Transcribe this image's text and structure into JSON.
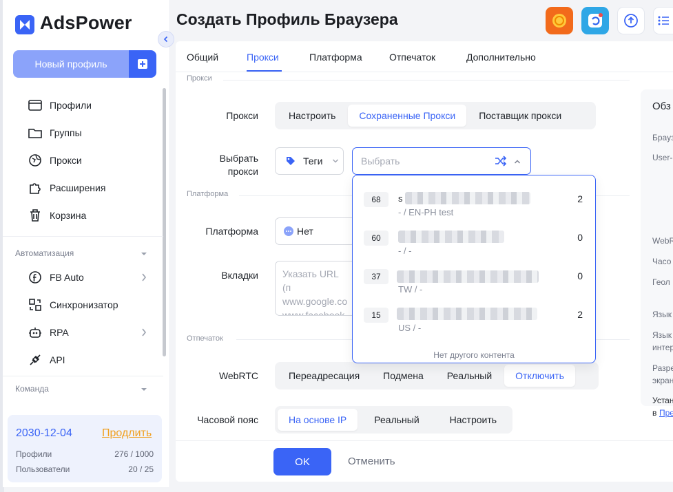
{
  "app": {
    "logo_text": "AdsPower"
  },
  "sidebar": {
    "new_profile": "Новый профиль",
    "items": [
      {
        "label": "Профили",
        "icon": "profiles-icon"
      },
      {
        "label": "Группы",
        "icon": "folder-icon"
      },
      {
        "label": "Прокси",
        "icon": "proxy-globe-icon"
      },
      {
        "label": "Расширения",
        "icon": "puzzle-icon"
      },
      {
        "label": "Корзина",
        "icon": "trash-icon"
      }
    ],
    "automation_title": "Автоматизация",
    "automation_items": [
      {
        "label": "FB Auto",
        "icon": "facebook-icon"
      },
      {
        "label": "Синхронизатор",
        "icon": "sync-icon"
      },
      {
        "label": "RPA",
        "icon": "robot-icon"
      },
      {
        "label": "API",
        "icon": "api-icon"
      }
    ],
    "team_title": "Команда",
    "subscription": {
      "date": "2030-12-04",
      "renew": "Продлить",
      "profiles_label": "Профили",
      "profiles_value": "276 / 1000",
      "users_label": "Пользователи",
      "users_value": "20 / 25"
    }
  },
  "page": {
    "title": "Создать Профиль Браузера"
  },
  "tabs": [
    "Общий",
    "Прокси",
    "Платформа",
    "Отпечаток",
    "Дополнительно"
  ],
  "proxy_section": {
    "title": "Прокси",
    "proxy_label": "Прокси",
    "proxy_options": [
      "Настроить",
      "Сохраненные Прокси",
      "Поставщик прокси"
    ],
    "select_label_1": "Выбрать",
    "select_label_2": "прокси",
    "tags_label": "Теги",
    "select_placeholder": "Выбрать"
  },
  "dropdown": {
    "items": [
      {
        "id": "68",
        "line1_prefix": "s",
        "line2": "- / EN-PH test",
        "count": "2"
      },
      {
        "id": "60",
        "line1_prefix": "",
        "line2": "- / -",
        "count": "0"
      },
      {
        "id": "37",
        "line1_prefix": "",
        "line2": "TW / -",
        "count": "0"
      },
      {
        "id": "15",
        "line1_prefix": "",
        "line2": "US / -",
        "count": "2"
      }
    ],
    "footer": "Нет другого контента"
  },
  "platform_section": {
    "title": "Платформа",
    "platform_label": "Платформа",
    "platform_value": "Нет",
    "tabs_label": "Вкладки",
    "tabs_placeholder_1": "Указать URL (п",
    "tabs_placeholder_2": "www.google.co",
    "tabs_placeholder_3": "www.facebook."
  },
  "fingerprint_section": {
    "title": "Отпечаток",
    "webrtc_label": "WebRTC",
    "webrtc_options": [
      "Переадресация",
      "Подмена",
      "Реальный",
      "Отключить"
    ],
    "timezone_label": "Часовой пояс",
    "timezone_options": [
      "На основе IP",
      "Реальный",
      "Настроить"
    ]
  },
  "overview": {
    "title": "Обз",
    "labels": [
      "Брауз",
      "User-",
      "WebR",
      "Часо",
      "Геол",
      "Язык",
      "Язык",
      "интер",
      "Разре",
      "экран",
      "Устан",
      "в"
    ],
    "link": "Пре"
  },
  "footer": {
    "ok": "OK",
    "cancel": "Отменить"
  },
  "colors": {
    "accent": "#3a64f6",
    "renew": "#f0a020"
  }
}
